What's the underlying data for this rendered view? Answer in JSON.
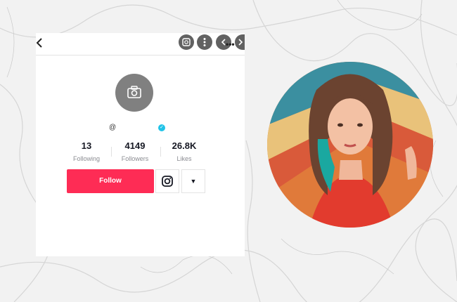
{
  "profile": {
    "username_prefix": "@",
    "stats": [
      {
        "value": "13",
        "label": "Following"
      },
      {
        "value": "4149",
        "label": "Followers"
      },
      {
        "value": "26.8K",
        "label": "Likes"
      }
    ],
    "follow_label": "Follow"
  },
  "icons": {
    "back": "back-arrow-icon",
    "qr": "qr-scan-icon",
    "more": "more-vertical-icon",
    "nav_prev": "chevron-left-icon",
    "nav_next": "chevron-right-icon",
    "camera": "camera-icon",
    "verified": "verified-badge-icon",
    "instagram": "instagram-icon",
    "dropdown": "caret-down-icon"
  },
  "colors": {
    "follow_button": "#fe2c55",
    "verified_badge": "#20c3e8",
    "avatar_placeholder": "#808080"
  }
}
